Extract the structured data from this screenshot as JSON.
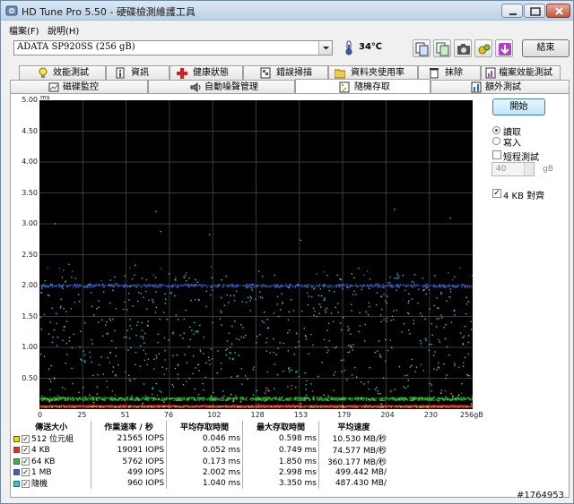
{
  "window": {
    "title": "HD Tune Pro 5.50 - 硬碟檢測維護工具"
  },
  "menu": [
    "檔案(F)",
    "說明(H)"
  ],
  "toolbar": {
    "drive": "ADATA SP920SS (256 gB)",
    "temperature": "34℃",
    "exit_label": "結束",
    "buttons": [
      "copy-text-icon",
      "copy-info-icon",
      "screenshot-icon",
      "options-icon",
      "save-icon"
    ]
  },
  "tabs_top": [
    {
      "label": "效能測試",
      "icon": "lightbulb-icon"
    },
    {
      "label": "資訊",
      "icon": "info-icon"
    },
    {
      "label": "健康狀態",
      "icon": "health-cross-icon"
    },
    {
      "label": "錯誤掃描",
      "icon": "scan-icon"
    },
    {
      "label": "資料夾使用率",
      "icon": "folder-icon"
    },
    {
      "label": "抹除",
      "icon": "trash-icon"
    },
    {
      "label": "檔案效能測試",
      "icon": "file-benchmark-icon"
    }
  ],
  "tabs_bottom": [
    {
      "label": "磁碟監控",
      "icon": "monitor-icon"
    },
    {
      "label": "自動噪聲管理",
      "icon": "speaker-icon"
    },
    {
      "label": "隨機存取",
      "icon": "random-access-icon",
      "active": true
    },
    {
      "label": "額外測試",
      "icon": "extra-test-icon"
    }
  ],
  "controls": {
    "start_label": "開始",
    "read_label": "讀取",
    "write_label": "寫入",
    "mode": "read",
    "short_test_label": "短程測試",
    "short_test_checked": false,
    "short_test_value": "40",
    "short_test_unit": "gB",
    "align_label": "4 KB 對齊",
    "align_checked": true
  },
  "chart_data": {
    "type": "scatter",
    "ylabel": "ms",
    "xlabel": "gB",
    "ylim": [
      0,
      5
    ],
    "xlim": [
      0,
      256
    ],
    "y_ticks": [
      "5.00",
      "4.50",
      "4.00",
      "3.50",
      "3.00",
      "2.50",
      "2.00",
      "1.50",
      "1.00",
      "0.50"
    ],
    "x_ticks": [
      "0",
      "25",
      "51",
      "76",
      "102",
      "128",
      "153",
      "179",
      "204",
      "230",
      "256gB"
    ],
    "grid": true,
    "series": [
      {
        "name": "512 位元組",
        "color": "#e8e000",
        "band_ms": [
          0.04,
          0.06
        ],
        "max_ms": 0.598
      },
      {
        "name": "4 KB",
        "color": "#e03030",
        "band_ms": [
          0.045,
          0.07
        ],
        "max_ms": 0.749
      },
      {
        "name": "64 KB",
        "color": "#30c030",
        "band_ms": [
          0.15,
          0.2
        ],
        "max_ms": 1.85
      },
      {
        "name": "1 MB",
        "color": "#3060e0",
        "band_ms": [
          1.98,
          2.03
        ],
        "max_ms": 2.998
      },
      {
        "name": "隨機",
        "color": "#30c8c8",
        "band_ms": [
          0.2,
          2.2
        ],
        "max_ms": 3.35
      }
    ]
  },
  "stats": {
    "headers": [
      "傳送大小",
      "作業速率 / 秒",
      "平均存取時間",
      "最大存取時間",
      "平均速度"
    ],
    "rows": [
      {
        "label": "512 位元組",
        "color": "#e8e000",
        "checked": true,
        "iops": "21565 IOPS",
        "avg": "0.046 ms",
        "max": "0.598 ms",
        "speed": "10.530 MB/秒"
      },
      {
        "label": "4 KB",
        "color": "#e03030",
        "checked": true,
        "iops": "19091 IOPS",
        "avg": "0.052 ms",
        "max": "0.749 ms",
        "speed": "74.577 MB/秒"
      },
      {
        "label": "64 KB",
        "color": "#30c030",
        "checked": true,
        "iops": "5762 IOPS",
        "avg": "0.173 ms",
        "max": "1.850 ms",
        "speed": "360.177 MB/秒"
      },
      {
        "label": "1 MB",
        "color": "#3060e0",
        "checked": true,
        "iops": "499 IOPS",
        "avg": "2.002 ms",
        "max": "2.998 ms",
        "speed": "499.442 MB/"
      },
      {
        "label": "隨機",
        "color": "#30c8c8",
        "checked": true,
        "iops": "960 IOPS",
        "avg": "1.040 ms",
        "max": "3.350 ms",
        "speed": "487.430 MB/"
      }
    ]
  },
  "watermark": "#1764953"
}
